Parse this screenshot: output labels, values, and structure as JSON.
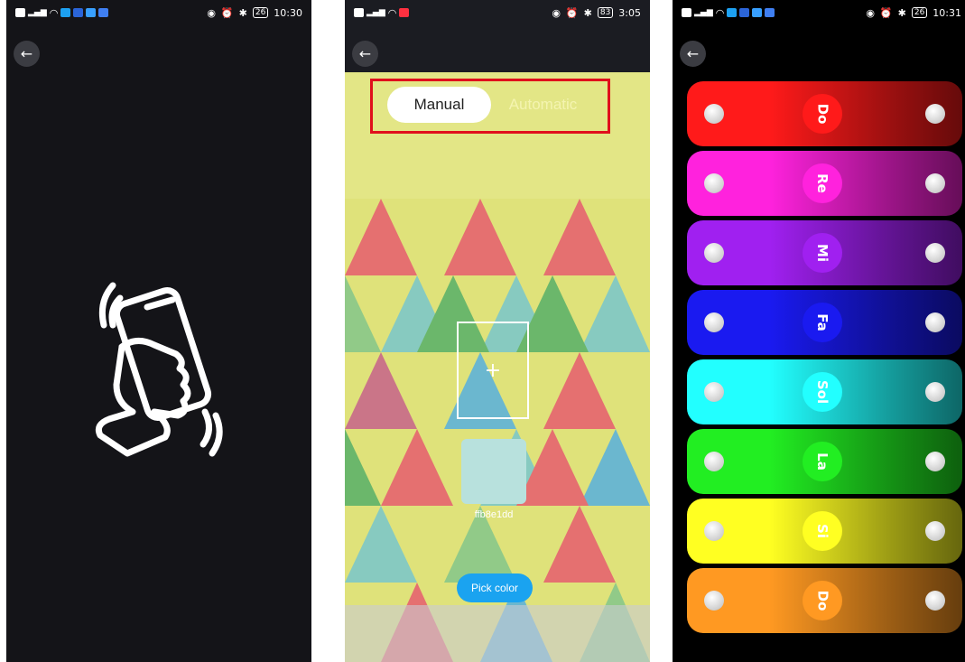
{
  "phone1": {
    "status": {
      "time": "10:30",
      "battery": "26"
    }
  },
  "phone2": {
    "status": {
      "time": "3:05",
      "battery": "83"
    },
    "modes": [
      "Manual",
      "Automatic"
    ],
    "active_mode": "Manual",
    "crosshair": "+",
    "swatch_color": "#b8e1dd",
    "color_code": "ffb8e1dd",
    "pick_label": "Pick color",
    "highlight_color": "#e0101c"
  },
  "phone3": {
    "status": {
      "time": "10:31",
      "battery": "26"
    },
    "bars": [
      {
        "note": "Do",
        "color": "#ff1a1a"
      },
      {
        "note": "Re",
        "color": "#ff22dd"
      },
      {
        "note": "Mi",
        "color": "#a020f0"
      },
      {
        "note": "Fa",
        "color": "#1a1af0"
      },
      {
        "note": "Sol",
        "color": "#22ffff"
      },
      {
        "note": "La",
        "color": "#22ee22"
      },
      {
        "note": "Si",
        "color": "#ffff22"
      },
      {
        "note": "Do",
        "color": "#ff9922"
      }
    ]
  }
}
